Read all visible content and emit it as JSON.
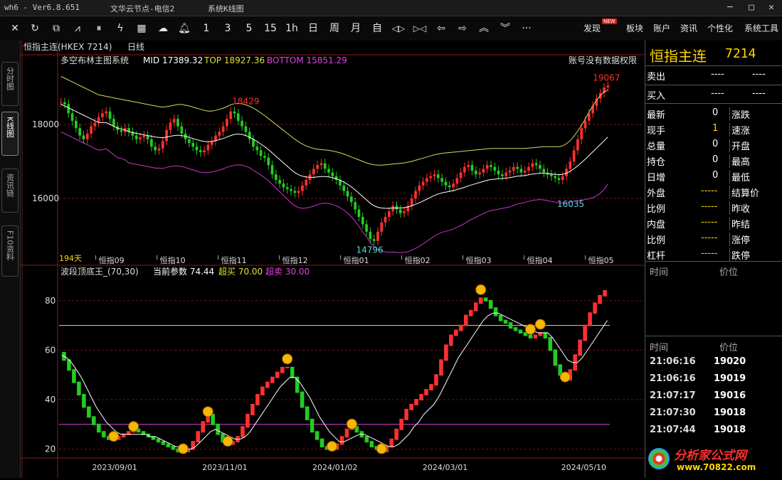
{
  "titlebar": {
    "left": "wh6  -  Ver6.8.651",
    "server": "文华云节点-电信2",
    "menu": "系统K线图"
  },
  "toolbar": {
    "icons": [
      "x-icon",
      "refresh-icon",
      "rectangles-icon",
      "line-chart-icon",
      "candle-icon",
      "tick-icon",
      "grid-icon",
      "cloud-icon",
      "bell-icon"
    ],
    "periods": [
      "1",
      "3",
      "5",
      "15",
      "1h",
      "日",
      "周",
      "月"
    ],
    "nav": [
      "自",
      "◁▷",
      "▷◁",
      "⇦",
      "⇨",
      "︽",
      "︾",
      "···"
    ],
    "right_items": [
      "发现",
      "板块",
      "账户",
      "资讯",
      "个性化",
      "系统工具"
    ],
    "new_badge": "NEW"
  },
  "left_tabs": [
    "分时图",
    "K线图",
    "资讯链",
    "F10资料"
  ],
  "chart_header": {
    "symbol": "恒指主连(HKEX 7214)",
    "period": "日线",
    "indicator": "多空布林主图系统",
    "mid": "MID 17389.32",
    "top": "TOP 18927.36",
    "bottom": "BOTTOM 15851.29",
    "notice": "账号没有数据权限"
  },
  "main_chart": {
    "ylim": [
      14500,
      19500
    ],
    "y_ticks": [
      16000,
      18000
    ],
    "x_labels": [
      "恒指09",
      "恒指10",
      "恒指11",
      "恒指12",
      "恒指01",
      "恒指02",
      "恒指03",
      "恒指04",
      "恒指05"
    ],
    "bars_count_label": "194天",
    "annotations": [
      {
        "label": "18429",
        "x": 0.335,
        "y": 18429
      },
      {
        "label": "14796",
        "x": 0.56,
        "y": 14796
      },
      {
        "label": "16035",
        "x": 0.925,
        "y": 16035
      },
      {
        "label": "19067",
        "x": 0.99,
        "y": 19067
      }
    ],
    "close": [
      18600,
      18550,
      18300,
      18100,
      17900,
      17700,
      17600,
      17750,
      17950,
      18050,
      18200,
      18300,
      18350,
      18150,
      17950,
      17850,
      17800,
      17900,
      17800,
      17700,
      17600,
      17650,
      17700,
      17600,
      17400,
      17300,
      17350,
      17550,
      17850,
      18050,
      18150,
      17950,
      17750,
      17600,
      17500,
      17400,
      17300,
      17250,
      17300,
      17450,
      17550,
      17700,
      17800,
      17950,
      18150,
      18350,
      18300,
      18100,
      17950,
      17800,
      17600,
      17400,
      17300,
      17150,
      17100,
      16900,
      16650,
      16500,
      16400,
      16300,
      16250,
      16200,
      16150,
      16200,
      16350,
      16500,
      16650,
      16800,
      16900,
      16950,
      16800,
      16700,
      16600,
      16500,
      16350,
      16200,
      16050,
      15900,
      15700,
      15500,
      15300,
      15100,
      14900,
      14850,
      15100,
      15350,
      15500,
      15650,
      15800,
      15700,
      15600,
      15650,
      15800,
      16000,
      16200,
      16350,
      16450,
      16550,
      16600,
      16650,
      16550,
      16450,
      16350,
      16300,
      16400,
      16550,
      16700,
      16850,
      16900,
      16750,
      16650,
      16700,
      16800,
      16900,
      16850,
      16750,
      16650,
      16600,
      16700,
      16750,
      16850,
      16800,
      16700,
      16750,
      16850,
      16950,
      16900,
      16800,
      16700,
      16650,
      16600,
      16550,
      16500,
      16600,
      16800,
      17000,
      17300,
      17600,
      17900,
      18100,
      18300,
      18500,
      18700,
      18850,
      19000,
      19050
    ],
    "mid_line": [
      18550,
      18500,
      18450,
      18400,
      18350,
      18300,
      18250,
      18200,
      18150,
      18100,
      18050,
      18050,
      18050,
      18000,
      17950,
      17900,
      17880,
      17850,
      17800,
      17780,
      17760,
      17740,
      17720,
      17700,
      17680,
      17660,
      17650,
      17640,
      17660,
      17680,
      17700,
      17710,
      17700,
      17680,
      17650,
      17620,
      17590,
      17560,
      17540,
      17530,
      17540,
      17560,
      17590,
      17620,
      17660,
      17700,
      17730,
      17740,
      17730,
      17700,
      17660,
      17600,
      17540,
      17470,
      17400,
      17320,
      17230,
      17140,
      17050,
      16960,
      16870,
      16780,
      16700,
      16640,
      16600,
      16580,
      16570,
      16570,
      16580,
      16590,
      16590,
      16580,
      16560,
      16530,
      16490,
      16440,
      16380,
      16310,
      16230,
      16140,
      16050,
      15960,
      15870,
      15800,
      15760,
      15740,
      15730,
      15730,
      15740,
      15740,
      15740,
      15750,
      15770,
      15800,
      15840,
      15880,
      15930,
      15980,
      16030,
      16080,
      16120,
      16150,
      16170,
      16190,
      16210,
      16240,
      16270,
      16300,
      16340,
      16370,
      16400,
      16430,
      16460,
      16490,
      16510,
      16520,
      16530,
      16540,
      16550,
      16560,
      16580,
      16600,
      16610,
      16620,
      16640,
      16660,
      16670,
      16680,
      16680,
      16670,
      16660,
      16650,
      16640,
      16650,
      16680,
      16730,
      16800,
      16880,
      16970,
      17060,
      17160,
      17260,
      17360,
      17460,
      17560,
      17660
    ],
    "top_line": [
      19300,
      19250,
      19200,
      19150,
      19100,
      19050,
      19000,
      18950,
      18900,
      18850,
      18800,
      18780,
      18760,
      18740,
      18720,
      18700,
      18680,
      18660,
      18640,
      18620,
      18600,
      18580,
      18560,
      18540,
      18520,
      18500,
      18480,
      18470,
      18480,
      18500,
      18520,
      18540,
      18540,
      18520,
      18500,
      18470,
      18440,
      18410,
      18380,
      18360,
      18360,
      18380,
      18410,
      18440,
      18480,
      18530,
      18560,
      18570,
      18560,
      18530,
      18490,
      18440,
      18380,
      18310,
      18240,
      18160,
      18080,
      18000,
      17920,
      17840,
      17760,
      17680,
      17600,
      17530,
      17470,
      17420,
      17380,
      17350,
      17330,
      17320,
      17310,
      17300,
      17280,
      17260,
      17230,
      17200,
      17160,
      17120,
      17080,
      17040,
      17000,
      16960,
      16930,
      16910,
      16900,
      16900,
      16910,
      16920,
      16930,
      16940,
      16950,
      16960,
      16980,
      17000,
      17030,
      17060,
      17090,
      17120,
      17150,
      17180,
      17200,
      17220,
      17230,
      17240,
      17250,
      17260,
      17270,
      17280,
      17290,
      17300,
      17310,
      17320,
      17330,
      17340,
      17350,
      17350,
      17350,
      17350,
      17350,
      17350,
      17350,
      17350,
      17350,
      17350,
      17360,
      17370,
      17380,
      17390,
      17400,
      17400,
      17400,
      17400,
      17400,
      17420,
      17480,
      17560,
      17680,
      17820,
      17980,
      18150,
      18330,
      18500,
      18650,
      18780,
      18880,
      18930
    ],
    "bottom_line": [
      17800,
      17750,
      17700,
      17650,
      17600,
      17550,
      17500,
      17450,
      17400,
      17350,
      17300,
      17320,
      17340,
      17260,
      17180,
      17100,
      17080,
      17040,
      16960,
      16940,
      16920,
      16900,
      16880,
      16860,
      16840,
      16820,
      16820,
      16810,
      16840,
      16860,
      16880,
      16880,
      16860,
      16840,
      16800,
      16770,
      16740,
      16710,
      16700,
      16700,
      16720,
      16740,
      16770,
      16800,
      16840,
      16870,
      16900,
      16910,
      16900,
      16870,
      16830,
      16760,
      16700,
      16630,
      16560,
      16480,
      16380,
      16280,
      16180,
      16080,
      15980,
      15880,
      15800,
      15750,
      15730,
      15740,
      15760,
      15790,
      15830,
      15860,
      15870,
      15860,
      15840,
      15800,
      15750,
      15680,
      15600,
      15500,
      15380,
      15240,
      15100,
      14960,
      14810,
      14690,
      14620,
      14580,
      14550,
      14540,
      14550,
      14540,
      14530,
      14540,
      14560,
      14600,
      14650,
      14700,
      14770,
      14840,
      14910,
      14980,
      15040,
      15080,
      15110,
      15140,
      15170,
      15220,
      15270,
      15320,
      15390,
      15440,
      15490,
      15540,
      15590,
      15640,
      15670,
      15690,
      15710,
      15730,
      15750,
      15770,
      15810,
      15850,
      15870,
      15890,
      15920,
      15950,
      15960,
      15970,
      15960,
      15940,
      15920,
      15900,
      15880,
      15880,
      15880,
      15900,
      15920,
      15940,
      15960,
      15970,
      15990,
      16020,
      16070,
      16140,
      16240,
      16390
    ]
  },
  "sub_chart": {
    "indicator": "波段顶底王_(70,30)",
    "params_label": "当前参数 74.44",
    "overbought_label": "超买 70.00",
    "oversold_label": "超卖 30.00",
    "ylim": [
      17,
      88
    ],
    "y_ticks": [
      20,
      40,
      60,
      80
    ],
    "overbought": 70,
    "oversold": 30,
    "x_labels": [
      "2023/09/01",
      "2023/11/01",
      "2024/01/02",
      "2024/03/01",
      "2024/05/10"
    ],
    "values": [
      59,
      56,
      52,
      47,
      42,
      37,
      33,
      30,
      27,
      25,
      24,
      24,
      25,
      26,
      27,
      28,
      27,
      26,
      25,
      24,
      23,
      22,
      21,
      20,
      19,
      19,
      20,
      23,
      27,
      31,
      34,
      30,
      26,
      23,
      22,
      23,
      25,
      29,
      34,
      38,
      42,
      45,
      47,
      49,
      51,
      53,
      53,
      49,
      43,
      37,
      32,
      27,
      24,
      21,
      20,
      20,
      22,
      25,
      28,
      29,
      27,
      25,
      23,
      21,
      20,
      19,
      21,
      24,
      28,
      32,
      36,
      38,
      40,
      42,
      44,
      46,
      50,
      56,
      62,
      66,
      68,
      70,
      74,
      76,
      79,
      81,
      80,
      77,
      74,
      72,
      71,
      69,
      68,
      67,
      66,
      65,
      66,
      67,
      65,
      60,
      54,
      50,
      48,
      52,
      58,
      64,
      70,
      75,
      79,
      82,
      84
    ],
    "signal": [
      58,
      57,
      55,
      52,
      49,
      45,
      41,
      37,
      34,
      31,
      29,
      27,
      26,
      26,
      26,
      26,
      26,
      26,
      25,
      25,
      24,
      23,
      22,
      21,
      21,
      20,
      20,
      21,
      23,
      25,
      27,
      28,
      27,
      26,
      25,
      24,
      24,
      25,
      27,
      30,
      33,
      36,
      39,
      42,
      45,
      47,
      49,
      49,
      47,
      44,
      41,
      37,
      33,
      30,
      27,
      25,
      23,
      23,
      24,
      25,
      26,
      26,
      25,
      24,
      23,
      22,
      21,
      21,
      22,
      24,
      26,
      29,
      31,
      34,
      36,
      38,
      41,
      45,
      49,
      53,
      57,
      60,
      63,
      66,
      69,
      72,
      74,
      75,
      75,
      74,
      73,
      72,
      71,
      70,
      69,
      68,
      67,
      67,
      67,
      65,
      62,
      59,
      56,
      55,
      55,
      57,
      60,
      63,
      66,
      69,
      72
    ]
  },
  "quote_panel": {
    "name": "恒指主连",
    "code": "7214",
    "sell_label": "卖出",
    "sell_value": "----",
    "sell_vol": "----",
    "buy_label": "买入",
    "buy_value": "----",
    "buy_vol": "----",
    "rows": [
      {
        "l": "最新",
        "v": "0",
        "r": "涨跌",
        "rv": ""
      },
      {
        "l": "现手",
        "v": "1",
        "r": "速涨",
        "rv": ""
      },
      {
        "l": "总量",
        "v": "0",
        "r": "开盘",
        "rv": ""
      },
      {
        "l": "持仓",
        "v": "0",
        "r": "最高",
        "rv": ""
      },
      {
        "l": "日增",
        "v": "0",
        "r": "最低",
        "rv": ""
      },
      {
        "l": "外盘",
        "v": "-----",
        "r": "结算价",
        "rv": ""
      },
      {
        "l": "比例",
        "v": "-----",
        "r": "昨收",
        "rv": ""
      },
      {
        "l": "内盘",
        "v": "-----",
        "r": "昨结",
        "rv": ""
      },
      {
        "l": "比例",
        "v": "-----",
        "r": "涨停",
        "rv": ""
      },
      {
        "l": "杠杆",
        "v": "-----",
        "r": "跌停",
        "rv": ""
      }
    ],
    "ticks_header1": {
      "time": "时间",
      "price": "价位"
    },
    "ticks_header2": {
      "time": "时间",
      "price": "价位"
    },
    "ticks": [
      {
        "time": "21:06:16",
        "price": "19020"
      },
      {
        "time": "21:06:16",
        "price": "19019"
      },
      {
        "time": "21:07:17",
        "price": "19016"
      },
      {
        "time": "21:07:30",
        "price": "19018"
      },
      {
        "time": "21:07:44",
        "price": "19018"
      }
    ],
    "watermark": "分析家公式网",
    "watermark_url": "www.70822.com"
  },
  "colors": {
    "up": "#ff3030",
    "down": "#22cc22",
    "mid": "#ffffff",
    "top": "#d8d860",
    "bottom": "#cc33cc",
    "grid": "#7a1010"
  }
}
